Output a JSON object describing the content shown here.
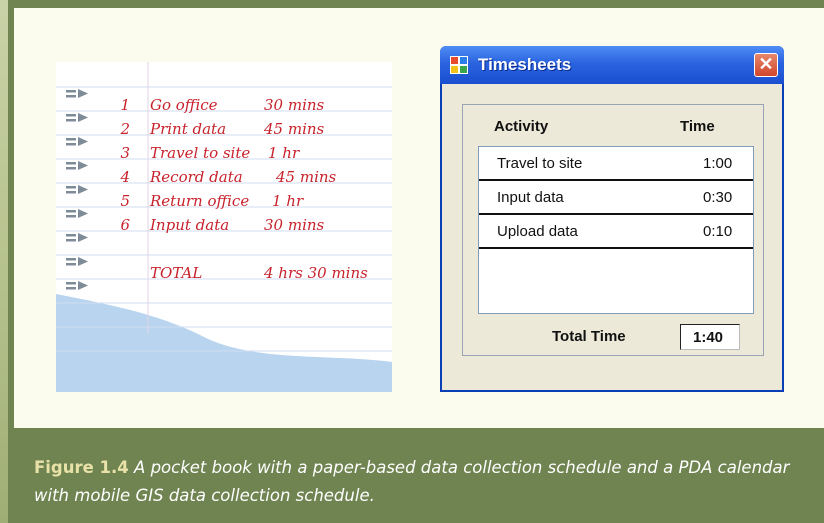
{
  "notebook": {
    "entries": [
      {
        "num": "1",
        "label": "Go office",
        "duration": "30 mins"
      },
      {
        "num": "2",
        "label": "Print data",
        "duration": "45 mins"
      },
      {
        "num": "3",
        "label": "Travel to site",
        "duration": "1 hr"
      },
      {
        "num": "4",
        "label": "Record data",
        "duration": "45 mins"
      },
      {
        "num": "5",
        "label": "Return office",
        "duration": "1 hr"
      },
      {
        "num": "6",
        "label": "Input data",
        "duration": "30 mins"
      }
    ],
    "total_label": "TOTAL",
    "total_value": "4 hrs 30 mins"
  },
  "window": {
    "title": "Timesheets",
    "close_glyph": "✕",
    "col_activity": "Activity",
    "col_time": "Time",
    "rows": [
      {
        "activity": "Travel to site",
        "time": "1:00"
      },
      {
        "activity": "Input data",
        "time": "0:30"
      },
      {
        "activity": "Upload data",
        "time": "0:10"
      }
    ],
    "total_label": "Total Time",
    "total_value": "1:40"
  },
  "caption": {
    "figure": "Figure 1.4",
    "text": "A pocket book with a paper-based data collection schedule and a PDA calendar with mobile GIS data collection schedule."
  },
  "colors": {
    "background": "#6f8450",
    "panel": "#fbfbee",
    "ink": "#c8232c",
    "paper_lines": "#aac4e6",
    "titlebar": "#2a63df"
  }
}
